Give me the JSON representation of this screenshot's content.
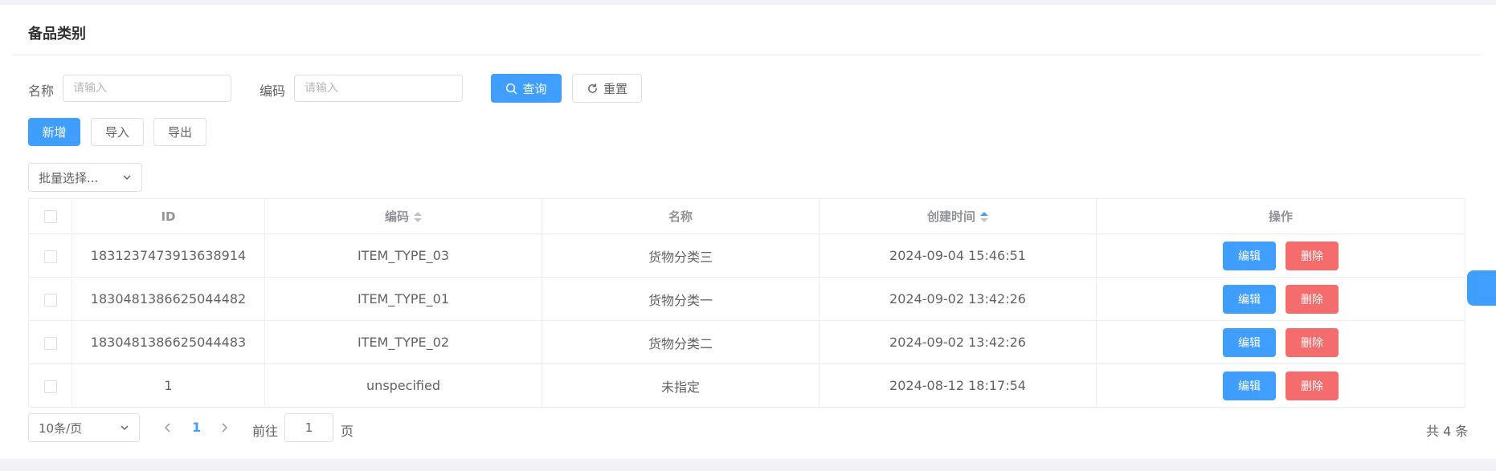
{
  "page": {
    "title": "备品类别"
  },
  "filters": {
    "name_label": "名称",
    "name_placeholder": "请输入",
    "code_label": "编码",
    "code_placeholder": "请输入",
    "query_label": "查询",
    "reset_label": "重置"
  },
  "toolbar": {
    "add_label": "新增",
    "import_label": "导入",
    "export_label": "导出",
    "batch_label": "批量选择..."
  },
  "table": {
    "columns": [
      "ID",
      "编码",
      "名称",
      "创建时间",
      "操作"
    ],
    "edit_label": "编辑",
    "delete_label": "删除",
    "rows": [
      {
        "id": "1831237473913638914",
        "code": "ITEM_TYPE_03",
        "name": "货物分类三",
        "created": "2024-09-04 15:46:51"
      },
      {
        "id": "1830481386625044482",
        "code": "ITEM_TYPE_01",
        "name": "货物分类一",
        "created": "2024-09-02 13:42:26"
      },
      {
        "id": "1830481386625044483",
        "code": "ITEM_TYPE_02",
        "name": "货物分类二",
        "created": "2024-09-02 13:42:26"
      },
      {
        "id": "1",
        "code": "unspecified",
        "name": "未指定",
        "created": "2024-08-12 18:17:54"
      }
    ]
  },
  "pagination": {
    "page_size": "10条/页",
    "current_page": "1",
    "goto_label": "前往",
    "goto_value": "1",
    "page_unit": "页",
    "total": "共 4 条"
  },
  "colors": {
    "primary": "#409eff",
    "danger": "#f56c6c",
    "border": "#dcdfe6"
  }
}
